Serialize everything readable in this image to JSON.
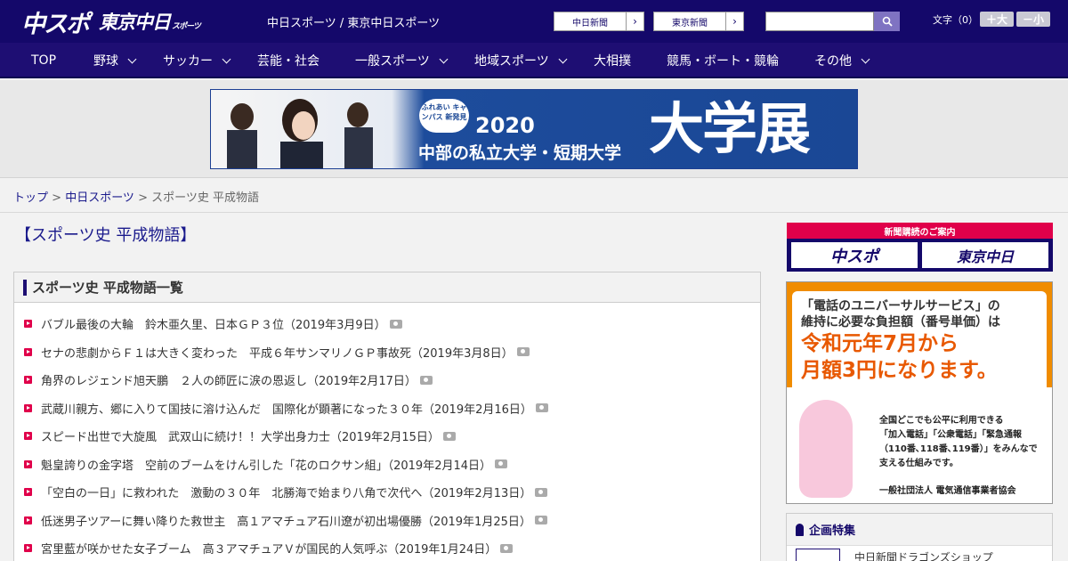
{
  "header": {
    "logo_main": "中スポ",
    "logo_sub": "東京中日",
    "logo_sub_small": "スポーツ",
    "tagline": "中日スポーツ / 東京中日スポーツ",
    "link_chunichi": "中日新聞",
    "link_tokyo": "東京新聞",
    "arrow": "›",
    "search_placeholder": "",
    "fontsize_label": "文字（0）",
    "font_plus": "＋大",
    "font_minus": "－小"
  },
  "nav": {
    "items": [
      "TOP",
      "野球",
      "サッカー",
      "芸能・社会",
      "一般スポーツ",
      "地域スポーツ",
      "大相撲",
      "競馬・ボート・競輪",
      "その他"
    ]
  },
  "banner": {
    "badge": "ふれあい キャンパス 新発見",
    "year": "2020",
    "sub": "中部の私立大学・短期大学",
    "big": "大学展"
  },
  "breadcrumb": {
    "home": "トップ",
    "sep": " > ",
    "section": "中日スポーツ",
    "current": "スポーツ史 平成物語"
  },
  "main": {
    "title": "【スポーツ史 平成物語】",
    "list_heading": "スポーツ史 平成物語一覧",
    "articles": [
      "バブル最後の大輪　鈴木亜久里、日本ＧＰ３位（2019年3月9日）",
      "セナの悲劇からＦ１は大きく変わった　平成６年サンマリノＧＰ事故死（2019年3月8日）",
      "角界のレジェンド旭天鵬　２人の師匠に涙の恩返し（2019年2月17日）",
      "武蔵川親方、郷に入りて国技に溶け込んだ　国際化が顕著になった３０年（2019年2月16日）",
      "スピード出世で大旋風　武双山に続け！！大学出身力士（2019年2月15日）",
      "魁皇誇りの金字塔　空前のブームをけん引した「花のロクサン組」（2019年2月14日）",
      "「空白の一日」に救われた　激動の３０年　北勝海で始まり八角で次代へ（2019年2月13日）",
      "低迷男子ツアーに舞い降りた救世主　高１アマチュア石川遼が初出場優勝（2019年1月25日）",
      "宮里藍が咲かせた女子ブーム　高３アマチュアＶが国民的人気呼ぶ（2019年1月24日）"
    ]
  },
  "sidebar": {
    "subscribe_heading": "新聞購読のご案内",
    "subscribe_a": "中スポ",
    "subscribe_b": "東京中日",
    "ad_line1": "「電話のユニバーサルサービス」の",
    "ad_line2": "維持に必要な負担額（番号単価）は",
    "ad_big1": "令和元年7月から",
    "ad_big2": "月額3円になります。",
    "ad_body1": "全国どこでも公平に利用できる",
    "ad_body2": "「加入電話」「公衆電話」「緊急通報",
    "ad_body3": "（110番､118番､119番）」をみんなで",
    "ad_body4": "支える仕組みです。",
    "ad_org": "一般社団法人 電気通信事業者協会",
    "feature_heading": "企画特集",
    "feature_item": "中日新聞ドラゴンズショップ"
  }
}
